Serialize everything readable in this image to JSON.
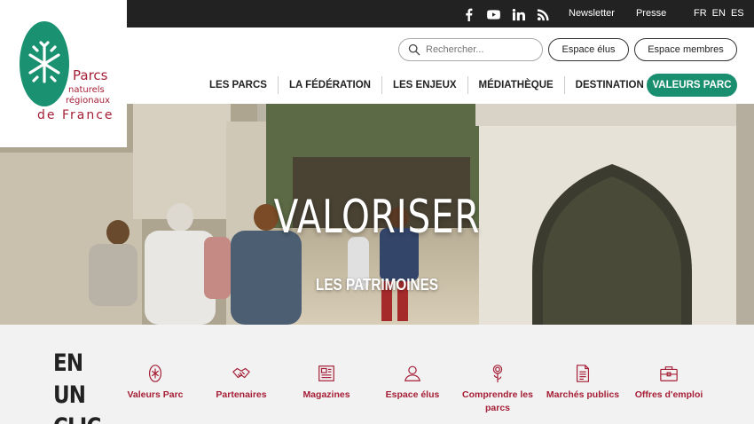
{
  "topbar": {
    "social": [
      "facebook-icon",
      "youtube-icon",
      "linkedin-icon",
      "rss-icon"
    ],
    "links": [
      "Newsletter",
      "Presse"
    ],
    "langs": [
      "FR",
      "EN",
      "ES"
    ]
  },
  "logo": {
    "line1": "Parcs",
    "line2": "naturels",
    "line3": "régionaux",
    "line4": "de France"
  },
  "header": {
    "search_placeholder": "Rechercher...",
    "espace_elus": "Espace élus",
    "espace_membres": "Espace membres"
  },
  "nav": {
    "items": [
      "LES PARCS",
      "LA FÉDÉRATION",
      "LES ENJEUX",
      "MÉDIATHÈQUE",
      "DESTINATION PARCS"
    ],
    "cta": "VALEURS PARC"
  },
  "hero": {
    "title": "VALORISER",
    "subtitle": "LES PATRIMOINES"
  },
  "quick": {
    "title": "EN UN CLIC",
    "items": [
      {
        "label": "Valeurs Parc",
        "icon": "badge-icon"
      },
      {
        "label": "Partenaires",
        "icon": "handshake-icon"
      },
      {
        "label": "Magazines",
        "icon": "magazine-icon"
      },
      {
        "label": "Espace élus",
        "icon": "user-icon"
      },
      {
        "label": "Comprendre les parcs",
        "icon": "flower-icon"
      },
      {
        "label": "Marchés publics",
        "icon": "document-icon"
      },
      {
        "label": "Offres d'emploi",
        "icon": "briefcase-icon"
      }
    ]
  },
  "colors": {
    "brand_green": "#1a8f6f",
    "brand_red": "#a51e36",
    "topbar": "#222222"
  }
}
